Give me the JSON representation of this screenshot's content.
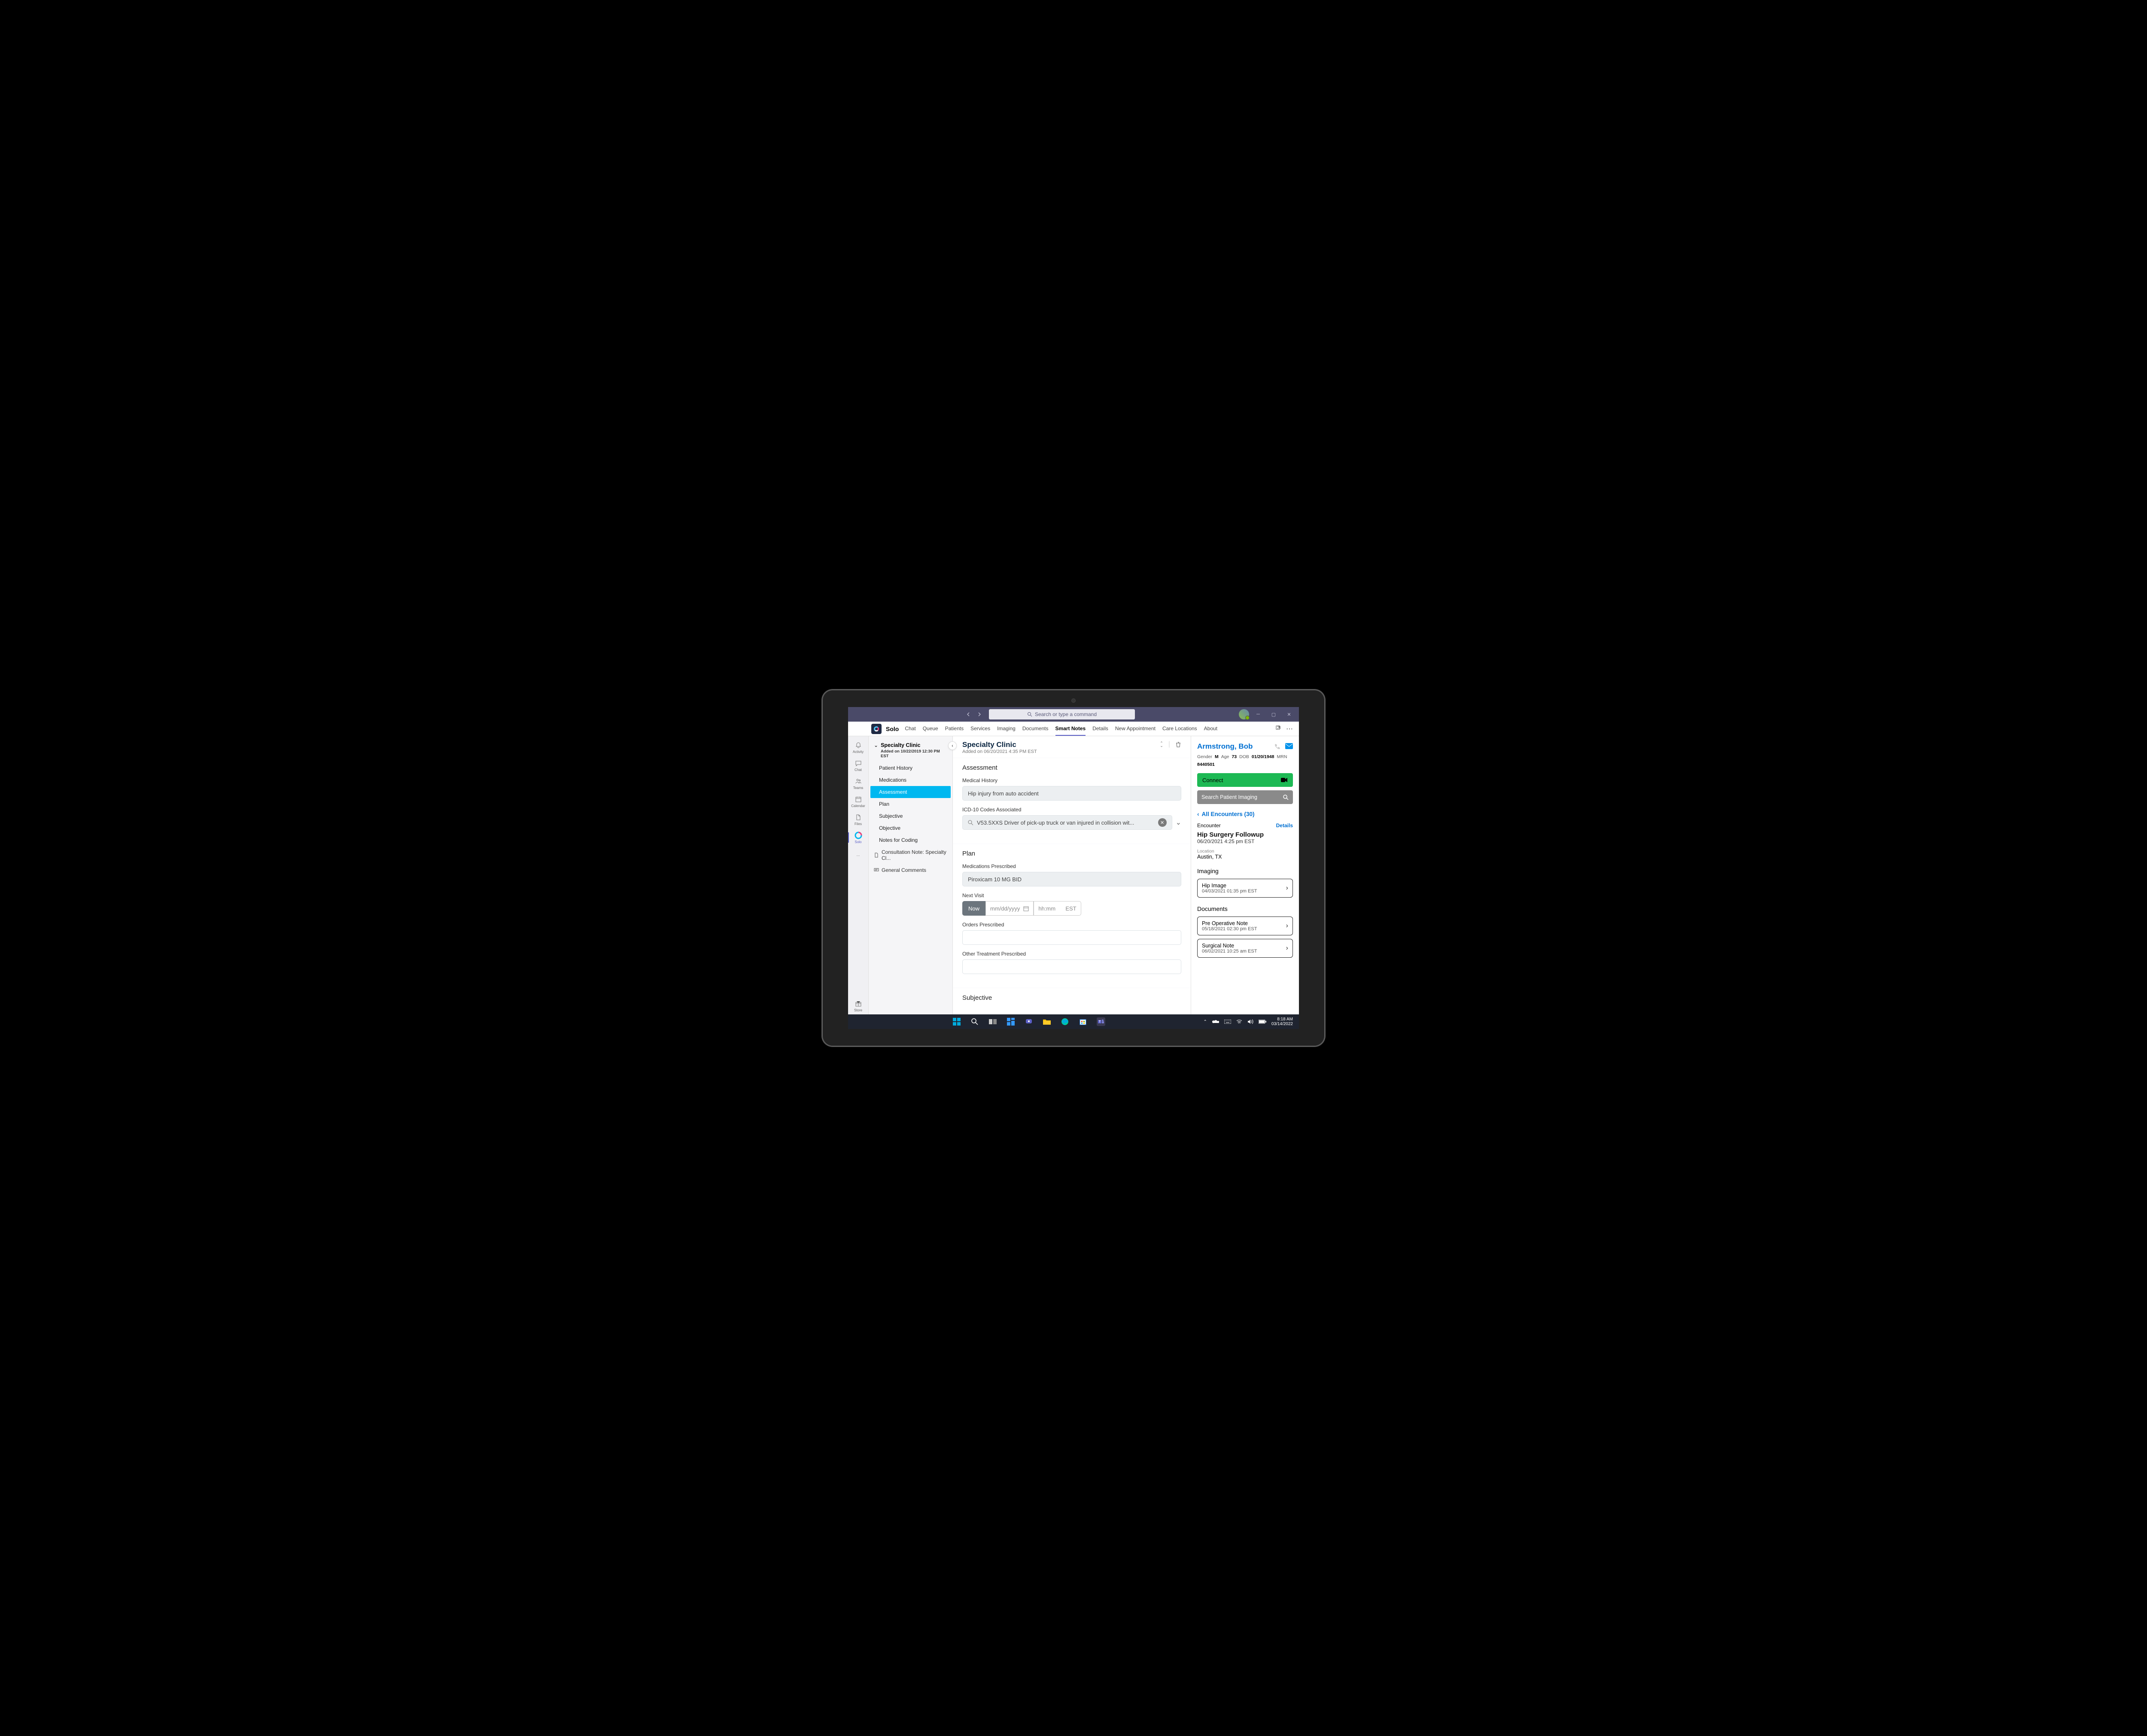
{
  "titlebar": {
    "search_placeholder": "Search or type a command"
  },
  "app": {
    "name": "Solo",
    "tabs": [
      "Chat",
      "Queue",
      "Patients",
      "Services",
      "Imaging",
      "Documents",
      "Smart Notes",
      "Details",
      "New Appointment",
      "Care Locations",
      "About"
    ],
    "active_tab": "Smart Notes"
  },
  "rail": {
    "items": [
      {
        "id": "activity",
        "label": "Activity"
      },
      {
        "id": "chat",
        "label": "Chat"
      },
      {
        "id": "teams",
        "label": "Teams"
      },
      {
        "id": "calendar",
        "label": "Calendar"
      },
      {
        "id": "files",
        "label": "Files"
      },
      {
        "id": "solo",
        "label": "Solo",
        "active": true
      },
      {
        "id": "more",
        "label": ""
      },
      {
        "id": "store",
        "label": "Store",
        "bottom": true
      }
    ]
  },
  "outline": {
    "title": "Specialty Clinic",
    "added": "Added on 10/22/2019 12:30 PM EST",
    "items": [
      "Patient History",
      "Medications",
      "Assessment",
      "Plan",
      "Subjective",
      "Objective",
      "Notes for Coding"
    ],
    "active": "Assessment",
    "note": "Consultation Note: Specialty Cl...",
    "comments": "General Comments"
  },
  "main": {
    "title": "Specialty Clinic",
    "added": "Added on 06/20/2021 4:35 PM EST",
    "assessment": {
      "heading": "Assessment",
      "history_label": "Medical History",
      "history_value": "Hip injury from auto accident",
      "icd_label": "ICD-10 Codes Associated",
      "icd_value": "V53.5XXS Driver of pick-up truck or van injured in collision wit..."
    },
    "plan": {
      "heading": "Plan",
      "meds_label": "Medications Prescribed",
      "meds_value": "Piroxicam 10 MG BID",
      "next_label": "Next Visit",
      "now": "Now",
      "date_ph": "mm/dd/yyyy",
      "time_ph": "hh:mm",
      "tz": "EST",
      "orders_label": "Orders Prescribed",
      "other_label": "Other Treatment Prescribed"
    },
    "subjective": {
      "heading": "Subjective"
    }
  },
  "patient": {
    "name": "Armstrong, Bob",
    "gender_label": "Gender",
    "gender": "M",
    "age_label": "Age",
    "age": "73",
    "dob_label": "DOB",
    "dob": "01/20/1948",
    "mrn_label": "MRN",
    "mrn": "8440501",
    "connect": "Connect",
    "img_search": "Search Patient Imaging",
    "all_enc": "All Encounters (30)",
    "encounter_label": "Encounter",
    "details": "Details",
    "enc_title": "Hip Surgery Followup",
    "enc_date": "06/20/2021 4:25 pm EST",
    "loc_label": "Location",
    "loc": "Austin, TX",
    "imaging_h": "Imaging",
    "imaging": [
      {
        "t": "Hip Image",
        "d": "04/03/2021 01:35 pm EST"
      }
    ],
    "docs_h": "Documents",
    "docs": [
      {
        "t": "Pre Operative Note",
        "d": "05/18/2021 02:30 pm EST"
      },
      {
        "t": "Surgical Note",
        "d": "06/02/2021 10:25 am EST"
      }
    ]
  },
  "taskbar": {
    "time": "8:18 AM",
    "date": "03/14/2022"
  }
}
